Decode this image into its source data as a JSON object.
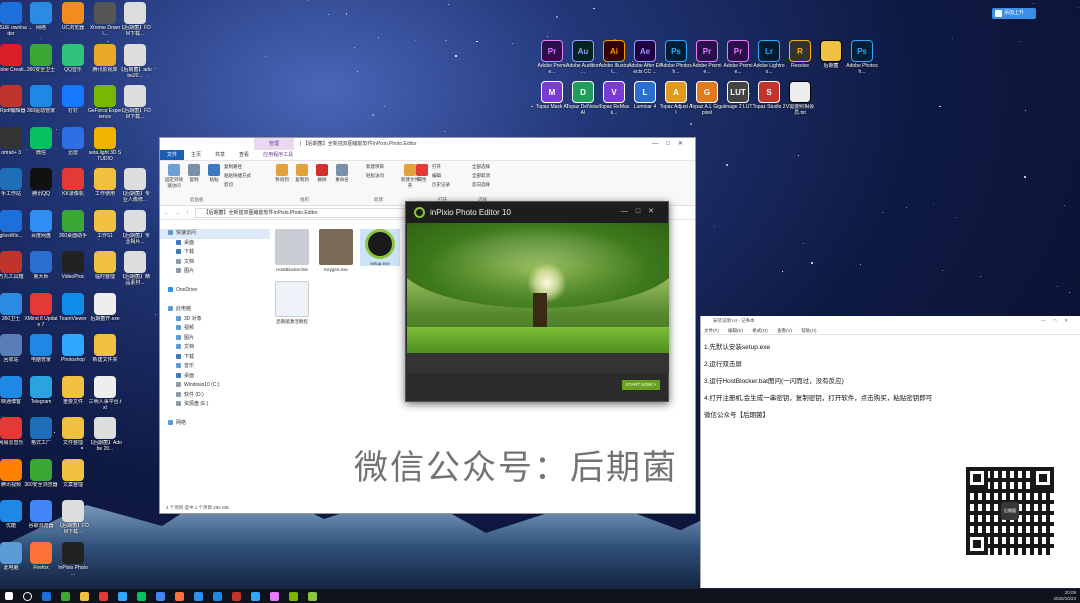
{
  "desktop": {
    "left_icons": [
      {
        "label": "MSUE ownloader",
        "color": "#1e6fd9"
      },
      {
        "label": "网络",
        "color": "#2a8be0"
      },
      {
        "label": "UC浏览器",
        "color": "#f28c1e"
      },
      {
        "label": "Xtreme Downl...",
        "color": "#555"
      },
      {
        "label": "【后期菌】FDM下载...",
        "color": "#ddd"
      },
      {
        "label": "Adobe Creati...",
        "color": "#da1f26"
      },
      {
        "label": "360安全卫士",
        "color": "#3aa835"
      },
      {
        "label": "QQ音乐",
        "color": "#31c27c"
      },
      {
        "label": "腾讯影视库",
        "color": "#e8a82a"
      },
      {
        "label": "【后期菌】adobe20...",
        "color": "#ddd"
      },
      {
        "label": "CRpdf编辑器",
        "color": "#c0342b"
      },
      {
        "label": "360驱动管家",
        "color": "#1e88e5"
      },
      {
        "label": "钉钉",
        "color": "#1677ff"
      },
      {
        "label": "GeForce Experience",
        "color": "#76b900"
      },
      {
        "label": "【后期菌】FDM下载...",
        "color": "#ddd"
      },
      {
        "label": "ortrait+ 3",
        "color": "#333"
      },
      {
        "label": "微信",
        "color": "#07c160"
      },
      {
        "label": "迅雷",
        "color": "#2f6fe4"
      },
      {
        "label": "seta.light 3D STUDIO",
        "color": "#f0b400"
      },
      {
        "label": "",
        "color": "transparent"
      },
      {
        "label": "手工作站",
        "color": "#1f6fb8"
      },
      {
        "label": "腾讯QQ",
        "color": "#111"
      },
      {
        "label": "KK录像机",
        "color": "#e53935"
      },
      {
        "label": "工作使用",
        "color": "#f0c040"
      },
      {
        "label": "【后期菌】专业人像修...",
        "color": "#ddd"
      },
      {
        "label": "gilosWin...",
        "color": "#1e6fd9"
      },
      {
        "label": "百度网盘",
        "color": "#2f8ef4"
      },
      {
        "label": "360桌面助手",
        "color": "#3aa835"
      },
      {
        "label": "工作S1",
        "color": "#f0c040"
      },
      {
        "label": "【后期菌】专业相片...",
        "color": "#ddd"
      },
      {
        "label": "万丸工具箱",
        "color": "#c0342b"
      },
      {
        "label": "鲁大师",
        "color": "#2a6fd0"
      },
      {
        "label": "VideoProc",
        "color": "#222"
      },
      {
        "label": "临时整理",
        "color": "#f0c040"
      },
      {
        "label": "【后期菌】精品素材...",
        "color": "#ddd"
      },
      {
        "label": "360卫士",
        "color": "#2a8be0"
      },
      {
        "label": "XMind 8 Update 7",
        "color": "#e53935"
      },
      {
        "label": "TeamViewer",
        "color": "#0e8ee9"
      },
      {
        "label": "后期菌开.exe",
        "color": "#eee"
      },
      {
        "label": "",
        "color": "transparent"
      },
      {
        "label": "回收站",
        "color": "#5b7db8"
      },
      {
        "label": "电脑管家",
        "color": "#1e88e5"
      },
      {
        "label": "Photoshop",
        "color": "#31a8ff"
      },
      {
        "label": "新建文件夹",
        "color": "#f0c040"
      },
      {
        "label": "",
        "color": "transparent"
      },
      {
        "label": "映通博客",
        "color": "#1e88e5"
      },
      {
        "label": "Telegram",
        "color": "#2aa3de"
      },
      {
        "label": "重要文件",
        "color": "#f0c040"
      },
      {
        "label": "三明人事平台.txt",
        "color": "#eee"
      },
      {
        "label": "",
        "color": "transparent"
      },
      {
        "label": "网易云音乐",
        "color": "#e53935"
      },
      {
        "label": "格式工厂",
        "color": "#1f6fb8"
      },
      {
        "label": "文件整理",
        "color": "#f0c040"
      },
      {
        "label": "【后期菌】Adobe 20...",
        "color": "#ddd"
      },
      {
        "label": "",
        "color": "transparent"
      },
      {
        "label": "腾讯视频",
        "color": "#ff7f00"
      },
      {
        "label": "360安全浏览器",
        "color": "#3aa835"
      },
      {
        "label": "文案整理",
        "color": "#f0c040"
      },
      {
        "label": "",
        "color": "transparent"
      },
      {
        "label": "",
        "color": "transparent"
      },
      {
        "label": "优酷",
        "color": "#1e88e5"
      },
      {
        "label": "谷歌浏览器",
        "color": "#4285f4"
      },
      {
        "label": "【后期菌】FDM下载...",
        "color": "#ddd"
      },
      {
        "label": "",
        "color": "transparent"
      },
      {
        "label": "",
        "color": "transparent"
      },
      {
        "label": "此电脑",
        "color": "#5b9bd5"
      },
      {
        "label": "Firefox",
        "color": "#ff7139"
      },
      {
        "label": "InPixio Photo ...",
        "color": "#222"
      }
    ],
    "right_icons": [
      {
        "abbr": "Pr",
        "label": "Adobe Premie...",
        "color": "#2a0f4a",
        "fg": "#e77cff"
      },
      {
        "abbr": "Au",
        "label": "Adobe Audition ...",
        "color": "#00241e",
        "fg": "#9999ff"
      },
      {
        "abbr": "Ai",
        "label": "Adobe Illustrat...",
        "color": "#330000",
        "fg": "#ff9a00"
      },
      {
        "abbr": "Ae",
        "label": "Adobe After Effects CC ...",
        "color": "#1f0040",
        "fg": "#9999ff"
      },
      {
        "abbr": "Ps",
        "label": "Adobe Photosh...",
        "color": "#001e36",
        "fg": "#31a8ff"
      },
      {
        "abbr": "Pr",
        "label": "Adobe Premie...",
        "color": "#2a0f4a",
        "fg": "#e77cff"
      },
      {
        "abbr": "Pr",
        "label": "Adobe Premie...",
        "color": "#2a0f4a",
        "fg": "#e77cff"
      },
      {
        "abbr": "Lr",
        "label": "Adobe Lightroo...",
        "color": "#001a2e",
        "fg": "#31a8ff"
      },
      {
        "abbr": "R",
        "label": "Resolve",
        "color": "#333",
        "fg": "#ffb300"
      },
      {
        "abbr": "",
        "label": "后期菌",
        "color": "#f0c040",
        "fg": "#000"
      },
      {
        "abbr": "Ps",
        "label": "Adobe Photosh...",
        "color": "#001e36",
        "fg": "#31a8ff"
      },
      {
        "abbr": "M",
        "label": "Topaz Mask AI",
        "color": "#7a3bd1",
        "fg": "#fff"
      },
      {
        "abbr": "D",
        "label": "Topaz DeNoise AI",
        "color": "#1e9e5a",
        "fg": "#fff"
      },
      {
        "abbr": "V",
        "label": "Topaz ReMask...",
        "color": "#7a3bd1",
        "fg": "#fff"
      },
      {
        "abbr": "L",
        "label": "Luminar 4",
        "color": "#2a6fd0",
        "fg": "#fff"
      },
      {
        "abbr": "A",
        "label": "Topaz Adjust AI",
        "color": "#e09a1e",
        "fg": "#fff"
      },
      {
        "abbr": "G",
        "label": "Topaz A.I. Gigapixel",
        "color": "#e07a1e",
        "fg": "#fff"
      },
      {
        "abbr": "LUT",
        "label": "Image 2 LUT",
        "color": "#444",
        "fg": "#fff"
      },
      {
        "abbr": "S",
        "label": "Topaz Studio 2",
        "color": "#c0342b",
        "fg": "#fff"
      },
      {
        "abbr": "",
        "label": "V需要照相会员.txt",
        "color": "#eee",
        "fg": "#000"
      }
    ],
    "top_button": "添加上升"
  },
  "explorer": {
    "title": "| 【后期菌】全新插双图编能软件InPixio.Photo.Editor",
    "tool_tab": "管理",
    "tabs": [
      "文件",
      "主页",
      "共享",
      "查看",
      "应用程序工具"
    ],
    "ribbon_buttons": [
      "固定到快速访问",
      "复制",
      "粘贴",
      "复制路径",
      "粘贴快捷方式",
      "剪切",
      "移动到",
      "复制到",
      "删除",
      "重命名",
      "新建项目",
      "轻松访问",
      "新建文件夹",
      "属性",
      "打开",
      "编辑",
      "历史记录",
      "全部选择",
      "全部取消",
      "反向选择"
    ],
    "ribbon_groups": [
      "剪贴板",
      "组织",
      "新建",
      "打开",
      "选择"
    ],
    "address": "【后期菌】全新插双图编能软件InPixio.Photo.Editor",
    "nav": [
      {
        "label": "快速访问",
        "color": "#5b9bd5",
        "sel": true
      },
      {
        "label": "桌面",
        "color": "#3a78c2",
        "sel": false
      },
      {
        "label": "下载",
        "color": "#3a78c2",
        "sel": false
      },
      {
        "label": "文档",
        "color": "#8e9aa8",
        "sel": false
      },
      {
        "label": "图片",
        "color": "#8e9aa8",
        "sel": false
      },
      {
        "label": "",
        "color": "transparent",
        "sel": false
      },
      {
        "label": "OneDrive",
        "color": "#2f8ef4",
        "sel": false
      },
      {
        "label": "",
        "color": "transparent",
        "sel": false
      },
      {
        "label": "此电脑",
        "color": "#5b9bd5",
        "sel": false
      },
      {
        "label": "3D 对象",
        "color": "#5b9bd5",
        "sel": false
      },
      {
        "label": "视频",
        "color": "#5b9bd5",
        "sel": false
      },
      {
        "label": "图片",
        "color": "#5b9bd5",
        "sel": false
      },
      {
        "label": "文档",
        "color": "#5b9bd5",
        "sel": false
      },
      {
        "label": "下载",
        "color": "#3a78c2",
        "sel": false
      },
      {
        "label": "音乐",
        "color": "#5b9bd5",
        "sel": false
      },
      {
        "label": "桌面",
        "color": "#3a78c2",
        "sel": false
      },
      {
        "label": "Windows10 (C:)",
        "color": "#8e9aa8",
        "sel": false
      },
      {
        "label": "软件 (D:)",
        "color": "#8e9aa8",
        "sel": false
      },
      {
        "label": "资源盘 (E:)",
        "color": "#8e9aa8",
        "sel": false
      },
      {
        "label": "",
        "color": "transparent",
        "sel": false
      },
      {
        "label": "网络",
        "color": "#5b9bd5",
        "sel": false
      }
    ],
    "files": [
      {
        "label": "HostBlocker.bat",
        "color": "#c8ccd2"
      },
      {
        "label": "Keygen.exe",
        "color": "#7a6a55"
      },
      {
        "label": "setup.exe",
        "color": "#1a1a1a"
      },
      {
        "label": "后期菌激活教程",
        "color": "#eef3f9"
      }
    ],
    "status": "4 个项目    选中 1 个项目  286 MB"
  },
  "inpixio": {
    "title": "inPixio Photo Editor 10",
    "start_button": "START NOW >"
  },
  "notepad": {
    "title": "安装说明.txt - 记事本",
    "menu": [
      "文件(F)",
      "编辑(E)",
      "格式(O)",
      "查看(V)",
      "帮助(H)"
    ],
    "lines": [
      "1.先默认安装setup.exe",
      "2.运行双击屏",
      "3.运行HostBlocker.bat图问(一闪而过，没有反应)",
      "4.打开注册机,会生成一串密钥，复制密钥，打开软件，点击购买，粘贴密钥即可",
      "微信公众号【后期菌】"
    ]
  },
  "watermark": "微信公众号：后期菌",
  "qr_label": "后期菌",
  "taskbar": {
    "apps": [
      "#fff",
      "#1e6fd9",
      "#3aa835",
      "#f0c040",
      "#e53935",
      "#31a8ff",
      "#07c160",
      "#4285f4",
      "#ff7139",
      "#2f8ef4",
      "#1e88e5",
      "#c0342b",
      "#31a8ff",
      "#e77cff",
      "#76b900",
      "#8cc63f"
    ],
    "time": "20:09",
    "date": "2020/10/23"
  }
}
